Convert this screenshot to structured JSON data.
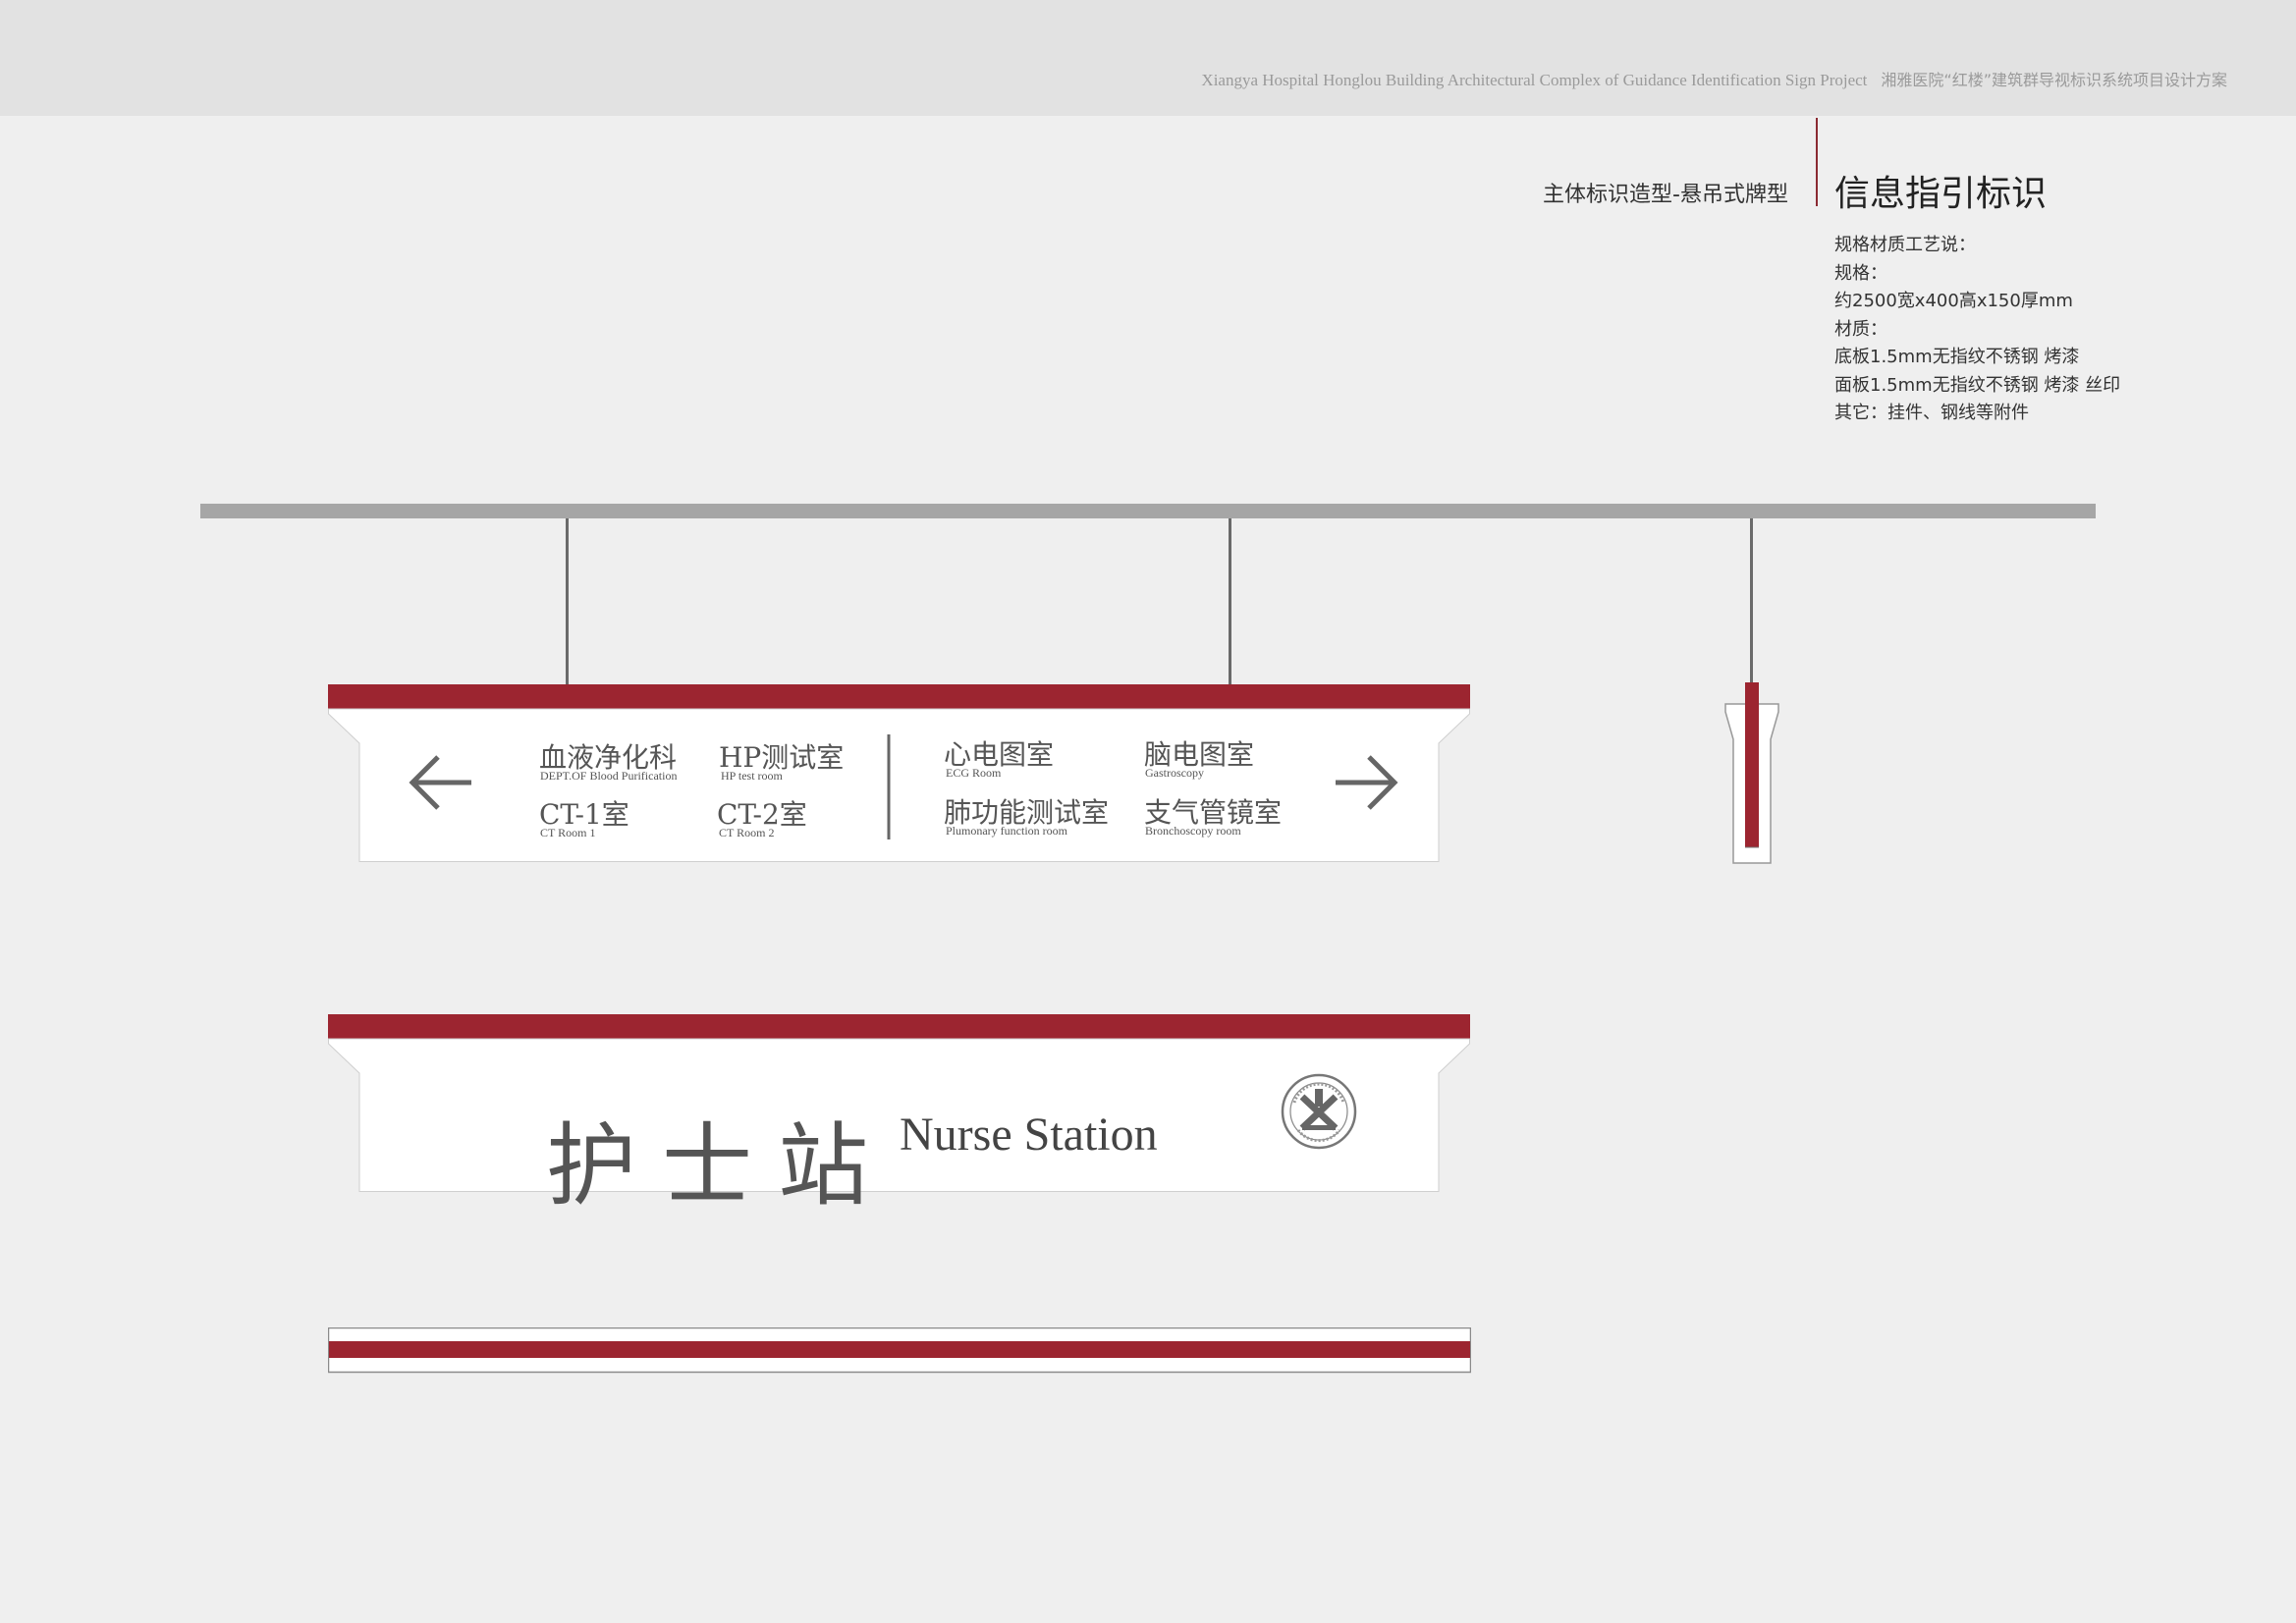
{
  "header": {
    "project_en": "Xiangya Hospital Honglou Building Architectural Complex of Guidance Identification Sign Project",
    "project_cn": "湘雅医院“红楼”建筑群导视标识系统项目设计方案"
  },
  "section": {
    "subtitle": "主体标识造型-悬吊式牌型",
    "title": "信息指引标识"
  },
  "spec": {
    "line1": "规格材质工艺说：",
    "line2": "规格：",
    "line3": "约2500宽x400高x150厚mm",
    "line4": "材质：",
    "line5": "底板1.5mm无指纹不锈钢 烤漆",
    "line6": "面板1.5mm无指纹不锈钢 烤漆 丝印",
    "line7": "其它：挂件、钢线等附件"
  },
  "sign_directory": {
    "left_group": [
      {
        "cn": "血液净化科",
        "en": "DEPT.OF Blood Purification"
      },
      {
        "cn": "HP测试室",
        "en": "HP test room"
      },
      {
        "cn": "CT-1室",
        "en": "CT Room 1"
      },
      {
        "cn": "CT-2室",
        "en": "CT Room 2"
      }
    ],
    "right_group": [
      {
        "cn": "心电图室",
        "en": "ECG Room"
      },
      {
        "cn": "脑电图室",
        "en": "Gastroscopy"
      },
      {
        "cn": "肺功能测试室",
        "en": "Plumonary function room"
      },
      {
        "cn": "支气管镜室",
        "en": "Bronchoscopy room"
      }
    ]
  },
  "sign_nurse": {
    "cn": "护士站",
    "en": "Nurse Station"
  },
  "icons": {
    "left": "arrow-left-icon",
    "right": "arrow-right-icon",
    "logo": "xiangya-hospital-logo"
  },
  "colors": {
    "accent": "#9c2530",
    "rail": "#a6a6a6",
    "background": "#efefef"
  }
}
